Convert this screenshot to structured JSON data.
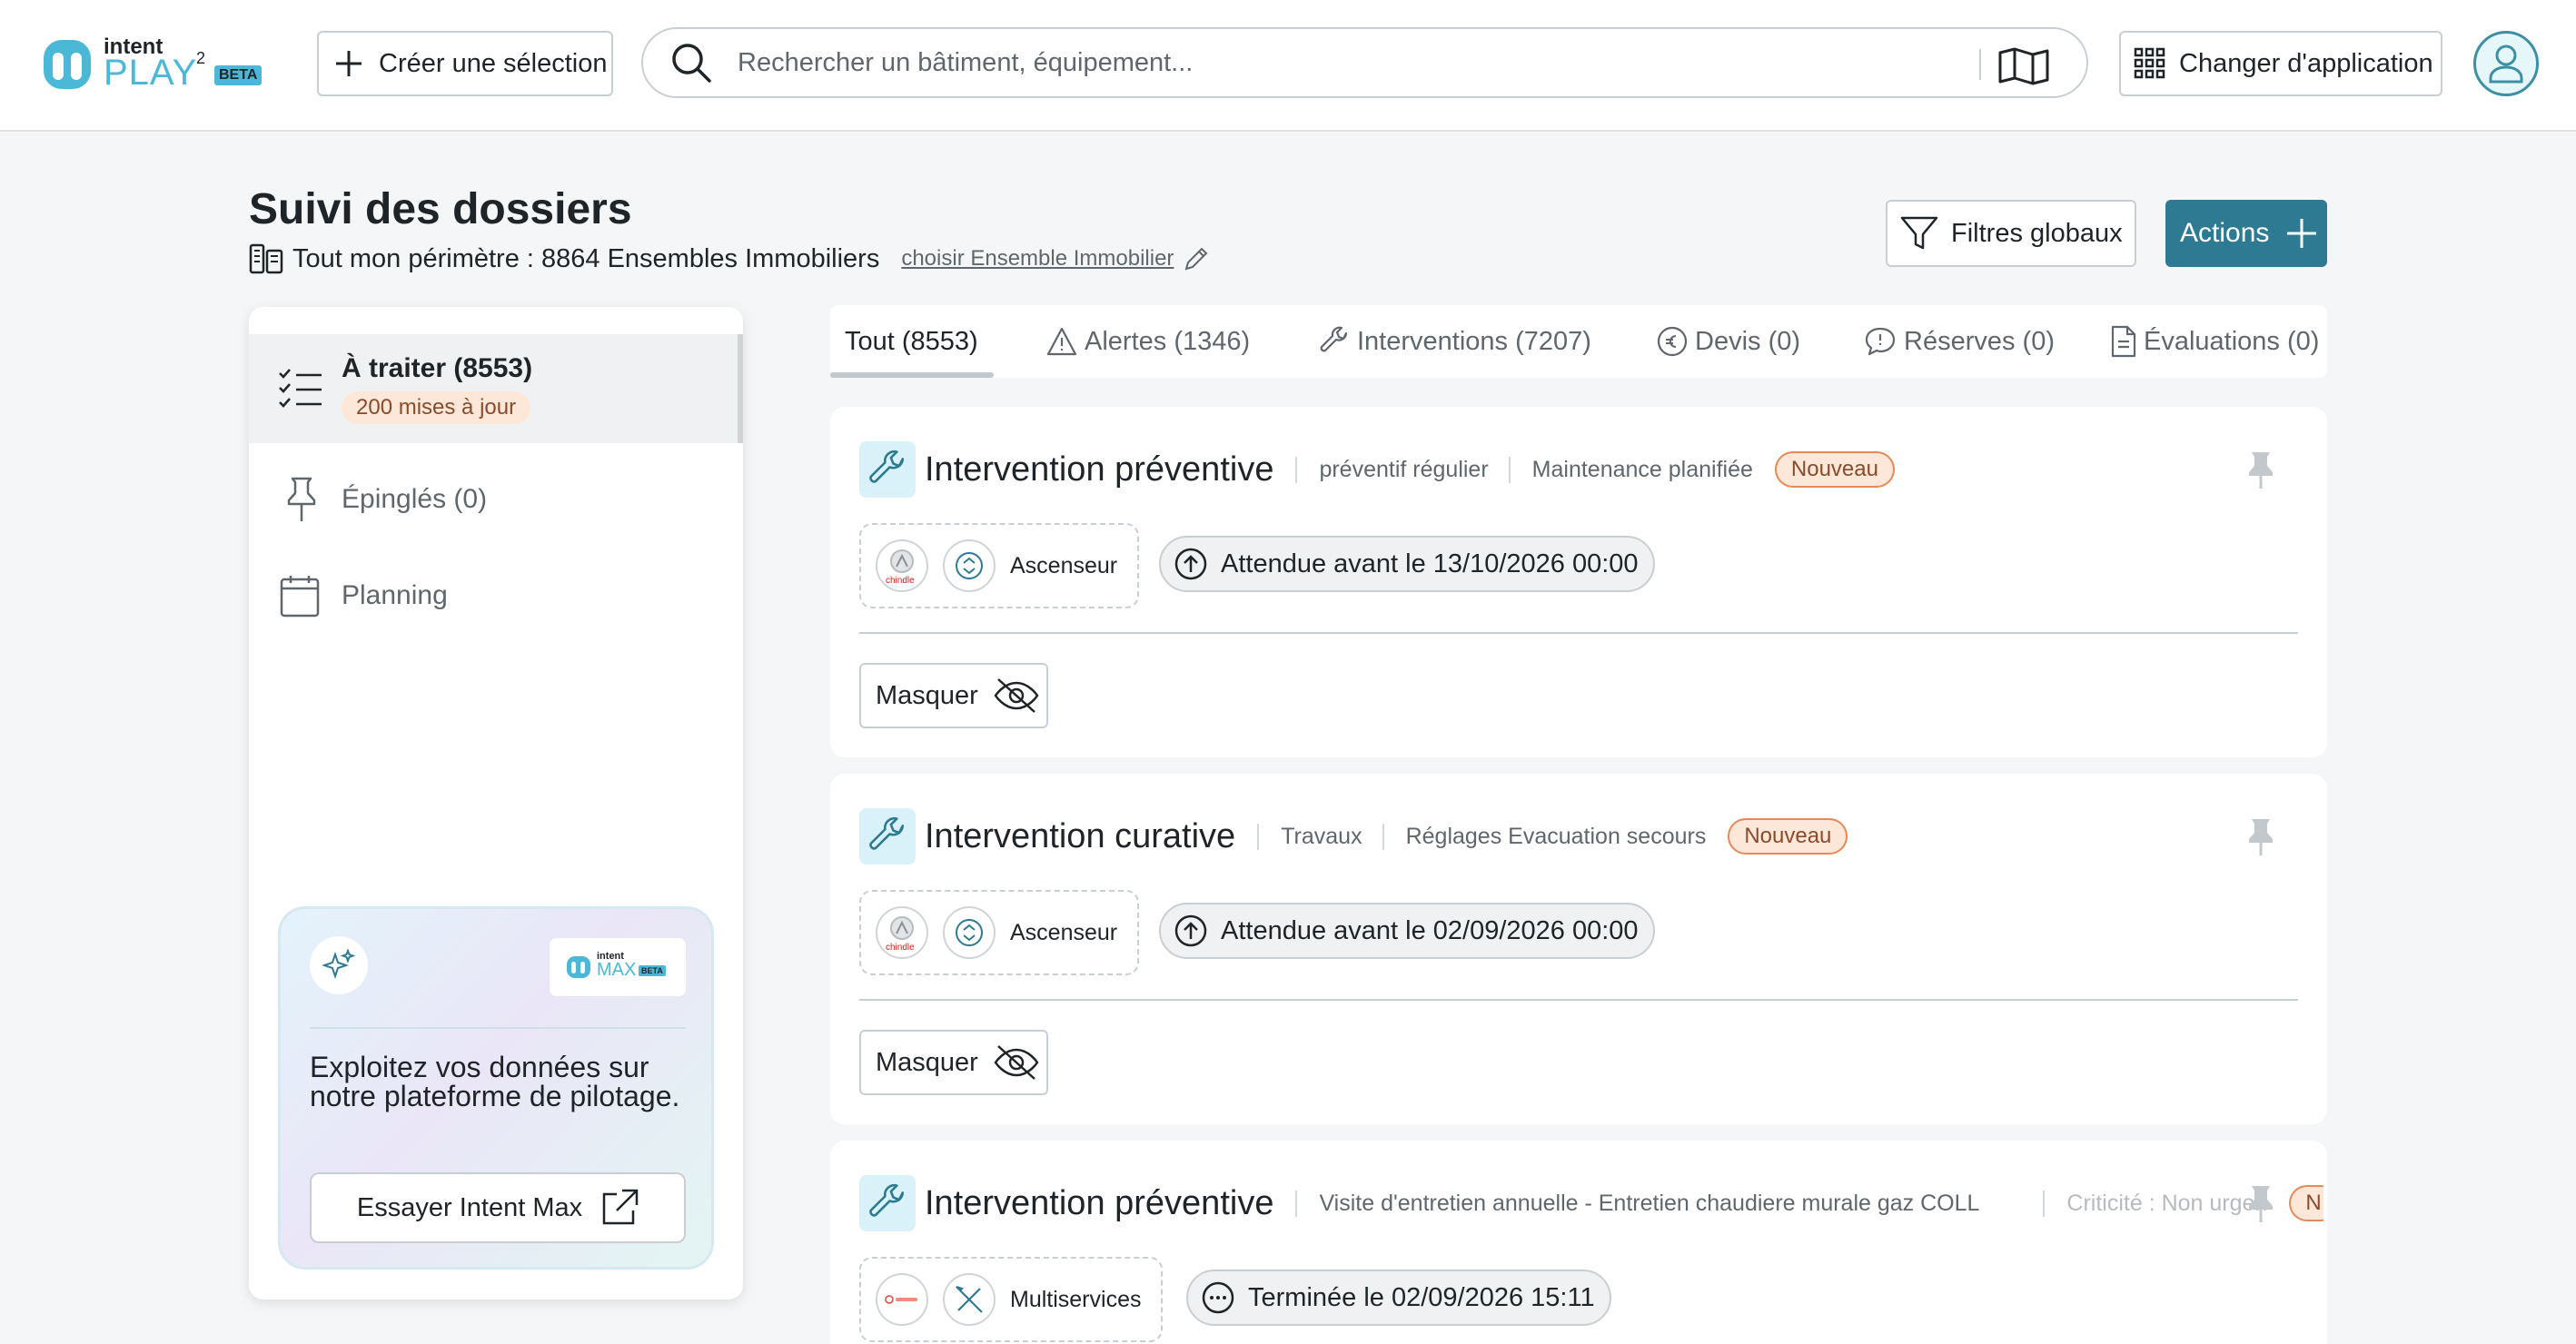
{
  "header": {
    "logo": {
      "brand_top": "intent",
      "brand_main": "PLAY",
      "superscript": "2",
      "badge": "BETA"
    },
    "create_selection_label": "Créer une sélection",
    "search_placeholder": "Rechercher un bâtiment, équipement...",
    "change_app_label": "Changer d'application"
  },
  "page": {
    "title": "Suivi des dossiers",
    "perimeter": "Tout mon périmètre : 8864 Ensembles Immobiliers",
    "choose_link": "choisir Ensemble Immobilier",
    "filters_label": "Filtres globaux",
    "actions_label": "Actions"
  },
  "sidebar": {
    "items": [
      {
        "label": "À traiter (8553)",
        "badge": "200 mises à jour",
        "icon": "checklist-icon",
        "active": true
      },
      {
        "label": "Épinglés (0)",
        "icon": "pin-icon"
      },
      {
        "label": "Planning",
        "icon": "calendar-icon"
      }
    ],
    "promo": {
      "logo_top": "intent",
      "logo_main": "MAX",
      "logo_badge": "BETA",
      "text": "Exploitez vos données sur notre plateforme de pilotage.",
      "button_label": "Essayer Intent Max"
    }
  },
  "tabs": [
    {
      "label": "Tout (8553)",
      "active": true
    },
    {
      "label": "Alertes (1346)",
      "icon": "warning-icon"
    },
    {
      "label": "Interventions (7207)",
      "icon": "wrench-icon"
    },
    {
      "label": "Devis (0)",
      "icon": "euro-icon"
    },
    {
      "label": "Réserves (0)",
      "icon": "comment-icon"
    },
    {
      "label": "Évaluations (0)",
      "icon": "document-icon"
    }
  ],
  "cards": [
    {
      "title": "Intervention préventive",
      "tags": [
        "préventif régulier",
        "Maintenance planifiée"
      ],
      "badge": "Nouveau",
      "equipment": "Ascenseur",
      "company_logo_text": "chindle",
      "due": "Attendue avant le 13/10/2026 00:00",
      "hide_label": "Masquer"
    },
    {
      "title": "Intervention curative",
      "tags": [
        "Travaux",
        "Réglages Evacuation secours"
      ],
      "badge": "Nouveau",
      "equipment": "Ascenseur",
      "company_logo_text": "chindle",
      "due": "Attendue avant le 02/09/2026 00:00",
      "hide_label": "Masquer"
    },
    {
      "title": "Intervention préventive",
      "tags": [
        "Visite d'entretien annuelle - Entretien chaudiere murale gaz COLL",
        "Criticité : Non urgen"
      ],
      "badge": "N",
      "equipment": "Multiservices",
      "due": "Terminée le 02/09/2026 15:11"
    }
  ],
  "colors": {
    "accent": "#2e7a93",
    "badge_bg": "#fde7d9",
    "badge_border": "#e78a55",
    "icon_bg": "#d9f1f8"
  }
}
